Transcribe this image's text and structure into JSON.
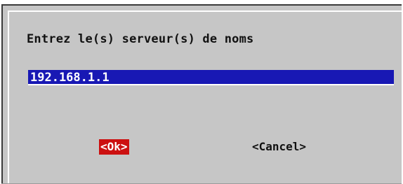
{
  "dialog": {
    "prompt": "Entrez le(s) serveur(s) de noms",
    "input_value": "192.168.1.1",
    "ok_label": "<Ok>",
    "cancel_label": "<Cancel>"
  },
  "colors": {
    "dialog_background": "#c6c6c6",
    "input_background": "#1818b4",
    "selected_button": "#cc1010",
    "text": "#111111"
  }
}
